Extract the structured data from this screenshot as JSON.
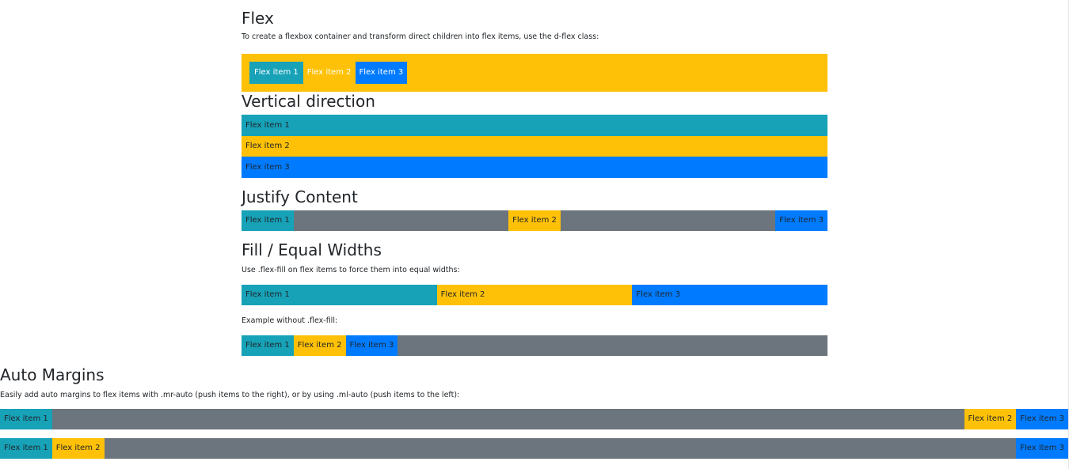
{
  "flex": {
    "title": "Flex",
    "desc": "To create a flexbox container and transform direct children into flex items, use the d-flex class:",
    "items": [
      "Flex item 1",
      "Flex item 2",
      "Flex item 3"
    ]
  },
  "vertical": {
    "title": "Vertical direction",
    "items": [
      "Flex item 1",
      "Flex item 2",
      "Flex item 3"
    ]
  },
  "justify": {
    "title": "Justify Content",
    "items": [
      "Flex item 1",
      "Flex item 2",
      "Flex item 3"
    ]
  },
  "fill": {
    "title": "Fill / Equal Widths",
    "desc": "Use .flex-fill on flex items to force them into equal widths:",
    "items": [
      "Flex item 1",
      "Flex item 2",
      "Flex item 3"
    ],
    "without_desc": "Example without .flex-fill:",
    "without_items": [
      "Flex item 1",
      "Flex item 2",
      "Flex item 3"
    ]
  },
  "auto": {
    "title": "Auto Margins",
    "desc": "Easily add auto margins to flex items with .mr-auto (push items to the right), or by using .ml-auto (push items to the left):",
    "row1": [
      "Flex item 1",
      "Flex item 2",
      "Flex item 3"
    ],
    "row2": [
      "Flex item 1",
      "Flex item 2",
      "Flex item 3"
    ]
  },
  "colors": {
    "info": "#17a2b8",
    "warning": "#ffc107",
    "primary": "#007bff",
    "secondary": "#6c757d"
  }
}
